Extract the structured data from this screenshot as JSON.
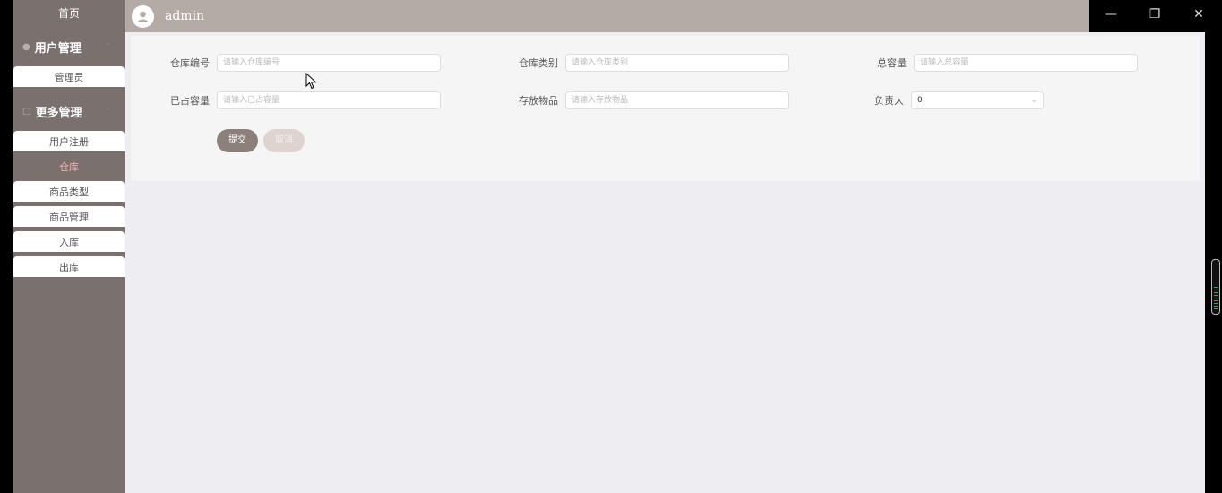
{
  "sidebar": {
    "home": "首页",
    "groups": [
      {
        "label": "用户管理",
        "items": [
          "管理员"
        ]
      },
      {
        "label": "更多管理",
        "items": [
          "用户注册",
          "仓库",
          "商品类型",
          "商品管理",
          "入库",
          "出库"
        ]
      }
    ]
  },
  "header": {
    "username": "admin"
  },
  "window": {
    "minimize": "—",
    "restore": "❐",
    "close": "✕"
  },
  "form": {
    "warehouse_no": {
      "label": "仓库编号",
      "placeholder": "请输入仓库编号"
    },
    "warehouse_type": {
      "label": "仓库类别",
      "placeholder": "请输入仓库类别"
    },
    "total_capacity": {
      "label": "总容量",
      "placeholder": "请输入总容量"
    },
    "used_capacity": {
      "label": "已占容量",
      "placeholder": "请输入已占容量"
    },
    "stored_goods": {
      "label": "存放物品",
      "placeholder": "请输入存放物品"
    },
    "manager": {
      "label": "负责人",
      "value": "0"
    },
    "submit": "提交",
    "cancel": "取消"
  },
  "colors": {
    "sidebar_bg": "#7a706e",
    "header_bg": "#b4aaa6",
    "active_item": "#f2b6b6",
    "submit_bg": "#8c807d",
    "cancel_bg": "#ddd4d2"
  }
}
